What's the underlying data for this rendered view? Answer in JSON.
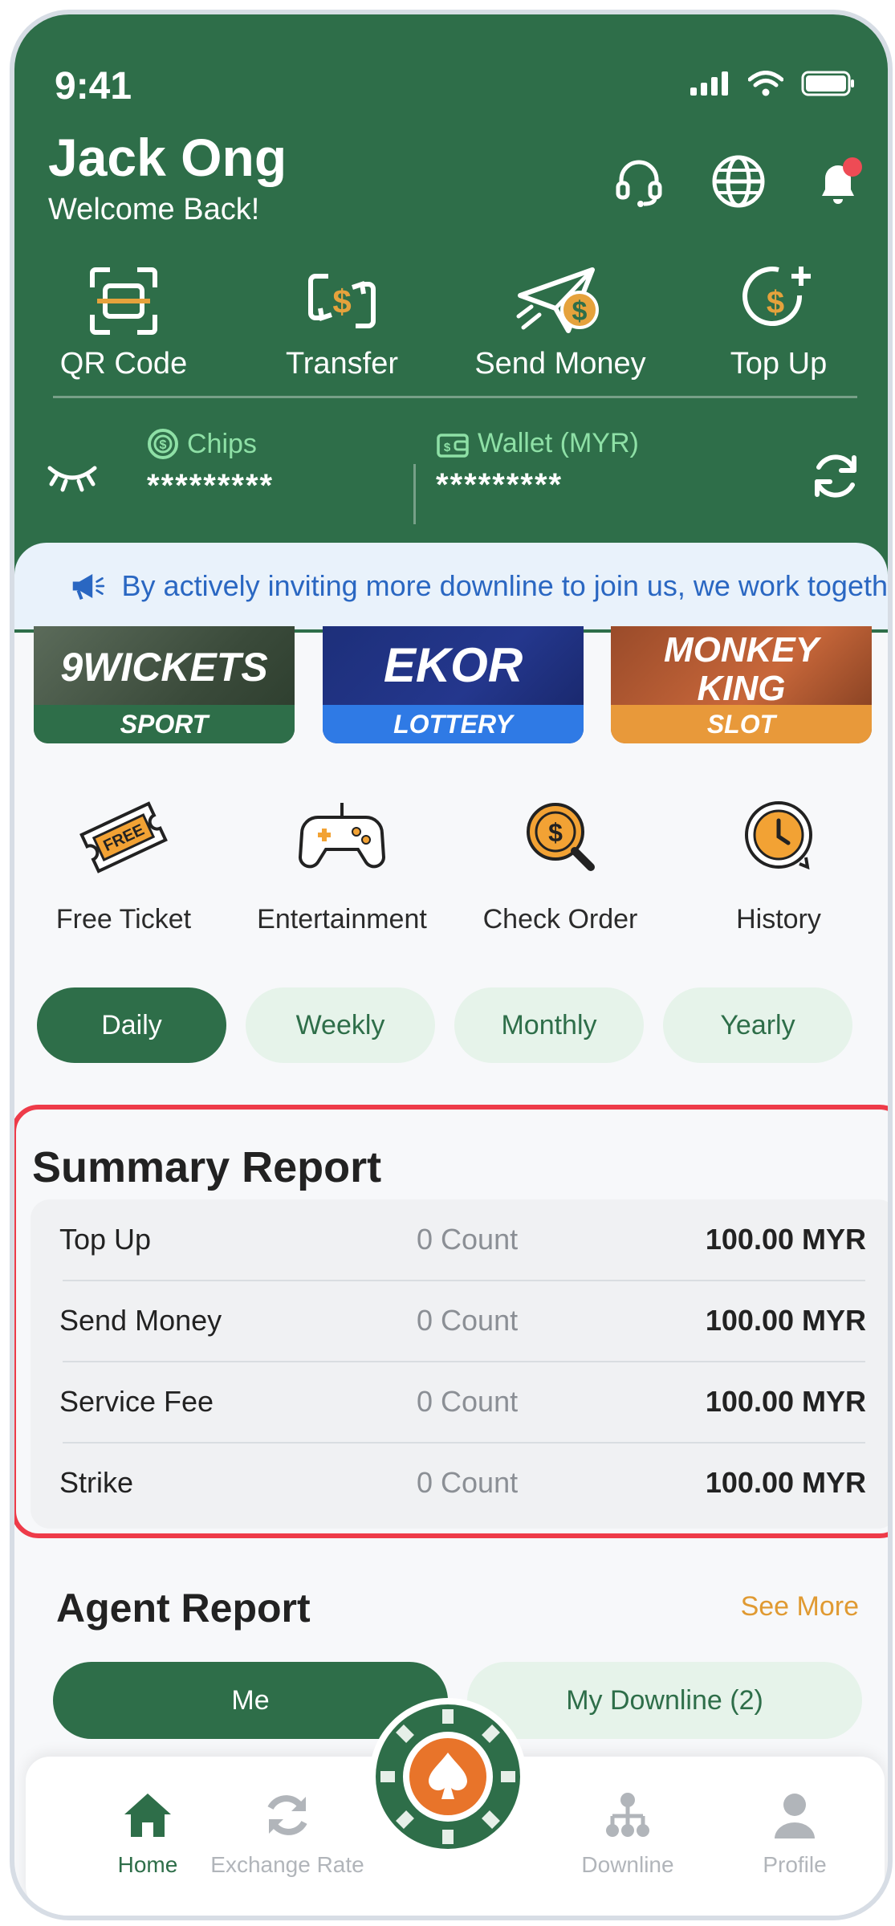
{
  "colors": {
    "primary": "#2e6e49",
    "accent": "#e09a32",
    "highlight": "#ee3b49",
    "link": "#2a67c2"
  },
  "status": {
    "time": "9:41"
  },
  "user": {
    "name": "Jack Ong",
    "welcome": "Welcome Back!"
  },
  "header_icons": [
    "headset-icon",
    "globe-icon",
    "bell-icon"
  ],
  "quick_actions": [
    {
      "label": "QR Code",
      "icon": "qr-scan-icon"
    },
    {
      "label": "Transfer",
      "icon": "transfer-icon"
    },
    {
      "label": "Send Money",
      "icon": "send-money-icon"
    },
    {
      "label": "Top Up",
      "icon": "top-up-icon"
    }
  ],
  "balance": {
    "chips_label": "Chips",
    "chips_value": "*********",
    "wallet_label": "Wallet (MYR)",
    "wallet_value": "*********"
  },
  "announcement": "By actively inviting more downline to join us, we work togeth",
  "games": [
    {
      "title": "9WICKETS",
      "category": "SPORT"
    },
    {
      "title": "EKOR",
      "category": "LOTTERY"
    },
    {
      "title": "MONKEY KING",
      "category": "SLOT"
    }
  ],
  "services": [
    {
      "label": "Free Ticket",
      "badge": "FREE"
    },
    {
      "label": "Entertainment"
    },
    {
      "label": "Check Order"
    },
    {
      "label": "History"
    }
  ],
  "periods": {
    "daily": "Daily",
    "weekly": "Weekly",
    "monthly": "Monthly",
    "yearly": "Yearly",
    "selected": "Daily"
  },
  "summary": {
    "title": "Summary Report",
    "rows": [
      {
        "name": "Top Up",
        "count": "0 Count",
        "amount": "100.00 MYR"
      },
      {
        "name": "Send Money",
        "count": "0 Count",
        "amount": "100.00 MYR"
      },
      {
        "name": "Service Fee",
        "count": "0 Count",
        "amount": "100.00 MYR"
      },
      {
        "name": "Strike",
        "count": "0 Count",
        "amount": "100.00 MYR"
      }
    ]
  },
  "agent": {
    "title": "Agent Report",
    "see_more": "See More",
    "tab_me": "Me",
    "tab_downline": "My Downline (2)"
  },
  "nav": {
    "home": "Home",
    "exchange": "Exchange Rate",
    "downline": "Downline",
    "profile": "Profile"
  }
}
